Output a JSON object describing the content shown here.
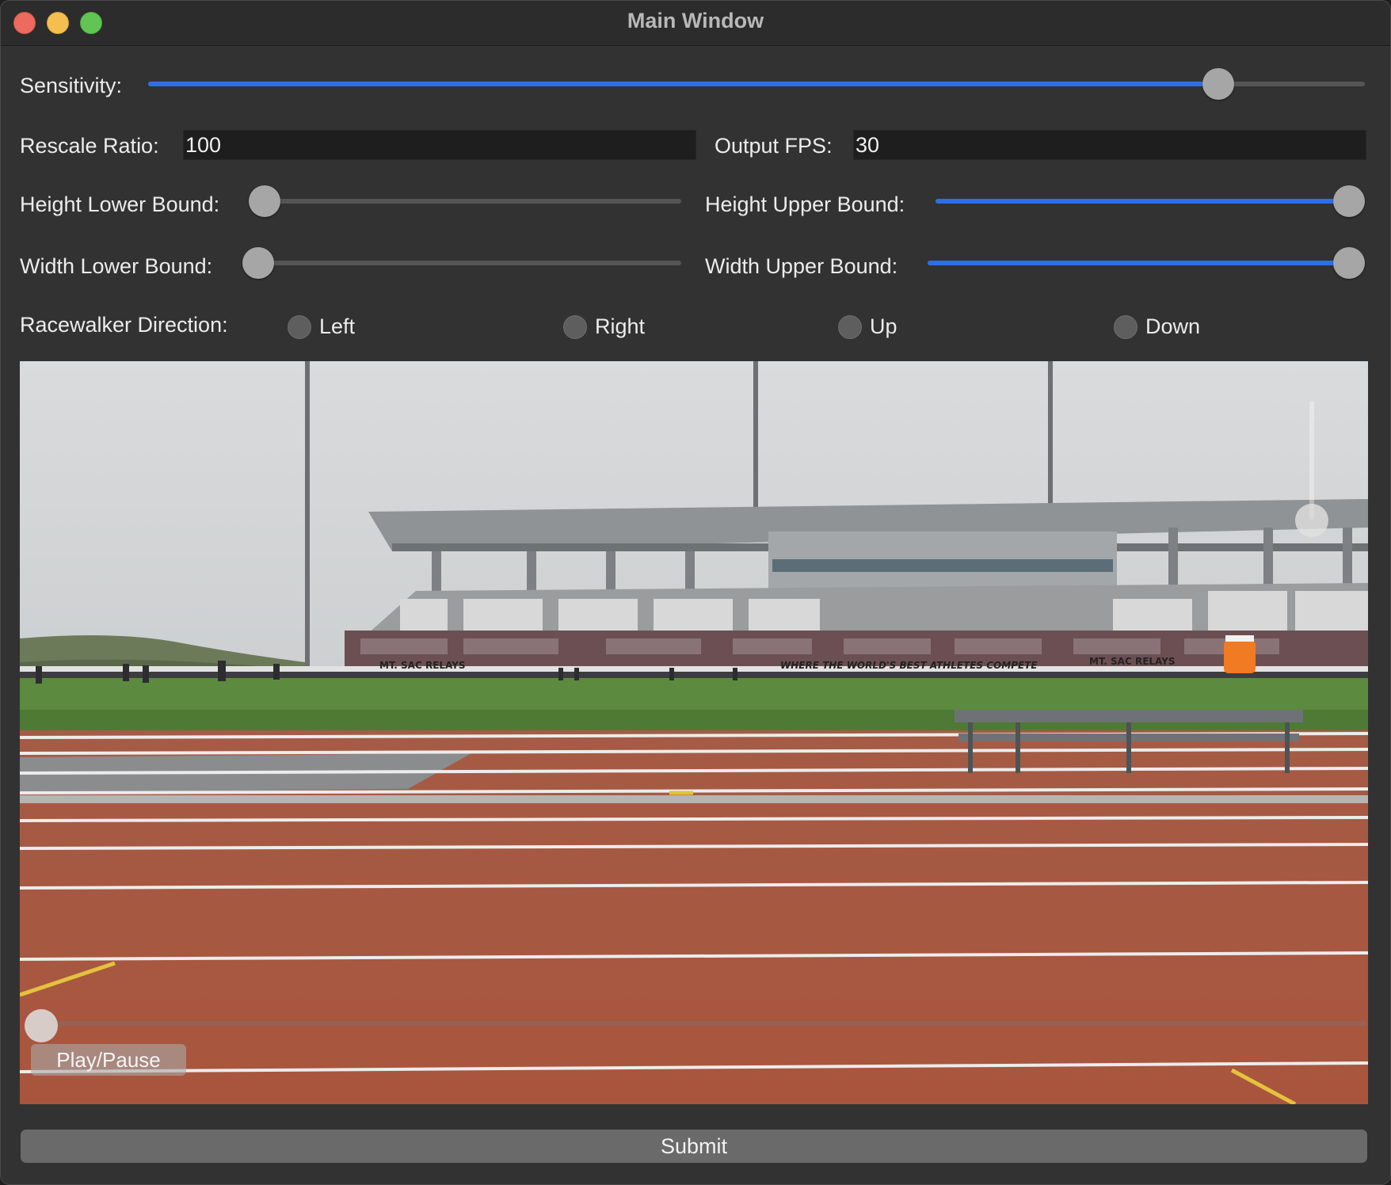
{
  "window": {
    "title": "Main Window"
  },
  "sensitivity": {
    "label": "Sensitivity:",
    "value": 0.89
  },
  "rescale_ratio": {
    "label": "Rescale Ratio:",
    "value": "100"
  },
  "output_fps": {
    "label": "Output FPS:",
    "value": "30"
  },
  "height_lower_bound": {
    "label": "Height Lower Bound:",
    "value": 0.0
  },
  "height_upper_bound": {
    "label": "Height Upper Bound:",
    "value": 1.0
  },
  "width_lower_bound": {
    "label": "Width Lower Bound:",
    "value": 0.0
  },
  "width_upper_bound": {
    "label": "Width Upper Bound:",
    "value": 1.0
  },
  "direction": {
    "label": "Racewalker Direction:",
    "options": [
      "Left",
      "Right",
      "Up",
      "Down"
    ]
  },
  "video": {
    "play_pause_label": "Play/Pause",
    "banner_text_1": "MT. SAC RELAYS",
    "banner_text_2": "WHERE THE WORLD'S BEST ATHLETES COMPETE",
    "banner_text_3": "MT. SAC RELAYS"
  },
  "submit_label": "Submit",
  "colors": {
    "accent": "#2f6fe6",
    "window_bg": "#323232"
  }
}
